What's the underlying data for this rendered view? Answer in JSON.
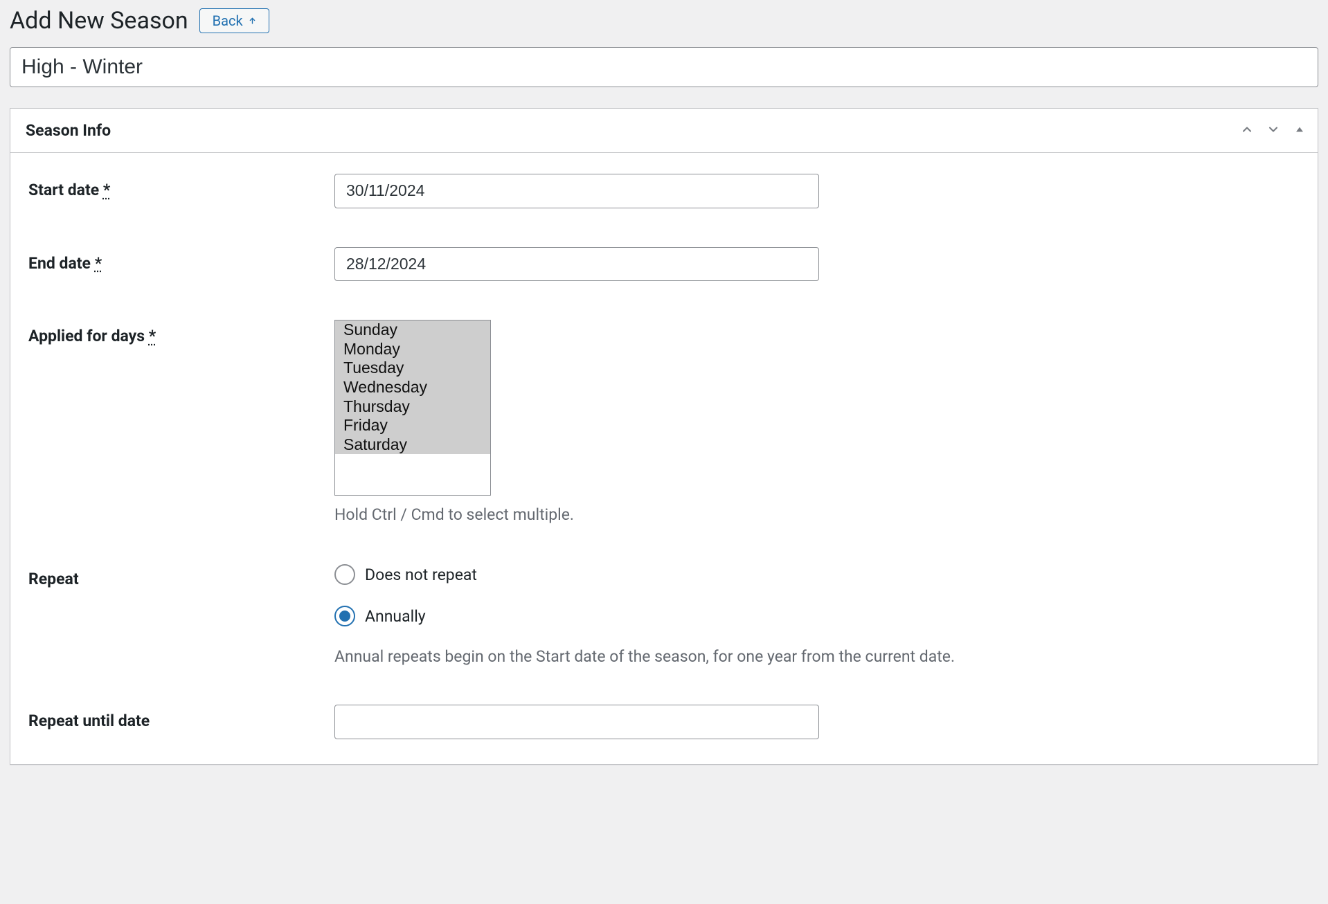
{
  "header": {
    "title": "Add New Season",
    "back_label": "Back"
  },
  "title_field": {
    "value": "High - Winter"
  },
  "panel": {
    "title": "Season Info"
  },
  "fields": {
    "start_date": {
      "label": "Start date ",
      "required_mark": "*",
      "value": "30/11/2024"
    },
    "end_date": {
      "label": "End date ",
      "required_mark": "*",
      "value": "28/12/2024"
    },
    "applied_days": {
      "label": "Applied for days ",
      "required_mark": "*",
      "options": [
        "Sunday",
        "Monday",
        "Tuesday",
        "Wednesday",
        "Thursday",
        "Friday",
        "Saturday"
      ],
      "help": "Hold Ctrl / Cmd to select multiple."
    },
    "repeat": {
      "label": "Repeat",
      "options": {
        "none": "Does not repeat",
        "annually": "Annually"
      },
      "selected": "annually",
      "help": "Annual repeats begin on the Start date of the season, for one year from the current date."
    },
    "repeat_until": {
      "label": "Repeat until date",
      "value": ""
    }
  }
}
